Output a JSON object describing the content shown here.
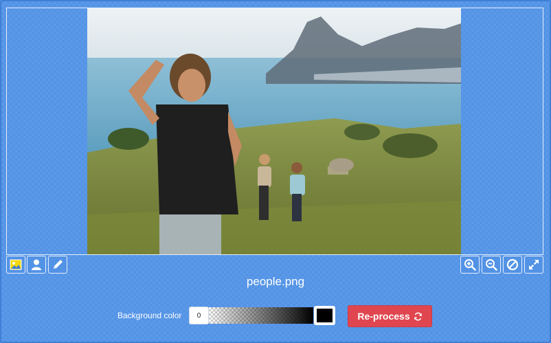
{
  "image": {
    "filename": "people.png",
    "description_icon": "photo-preview"
  },
  "toolbar_left": [
    {
      "name": "image-icon-button",
      "icon": "image-icon"
    },
    {
      "name": "person-icon-button",
      "icon": "person-icon"
    },
    {
      "name": "pencil-icon-button",
      "icon": "pencil-icon"
    }
  ],
  "toolbar_right": [
    {
      "name": "zoom-in-button",
      "icon": "zoom-in-icon"
    },
    {
      "name": "zoom-out-button",
      "icon": "zoom-out-icon"
    },
    {
      "name": "reset-button",
      "icon": "ban-icon"
    },
    {
      "name": "fullscreen-button",
      "icon": "expand-icon"
    }
  ],
  "controls": {
    "background_label": "Background color",
    "background_value": "0",
    "swatch_color": "#000000",
    "reprocess_label": "Re-process"
  },
  "colors": {
    "page_bg": "#5393e6",
    "accent_button": "#e0464f",
    "icon_highlight": "#f5d90a"
  }
}
